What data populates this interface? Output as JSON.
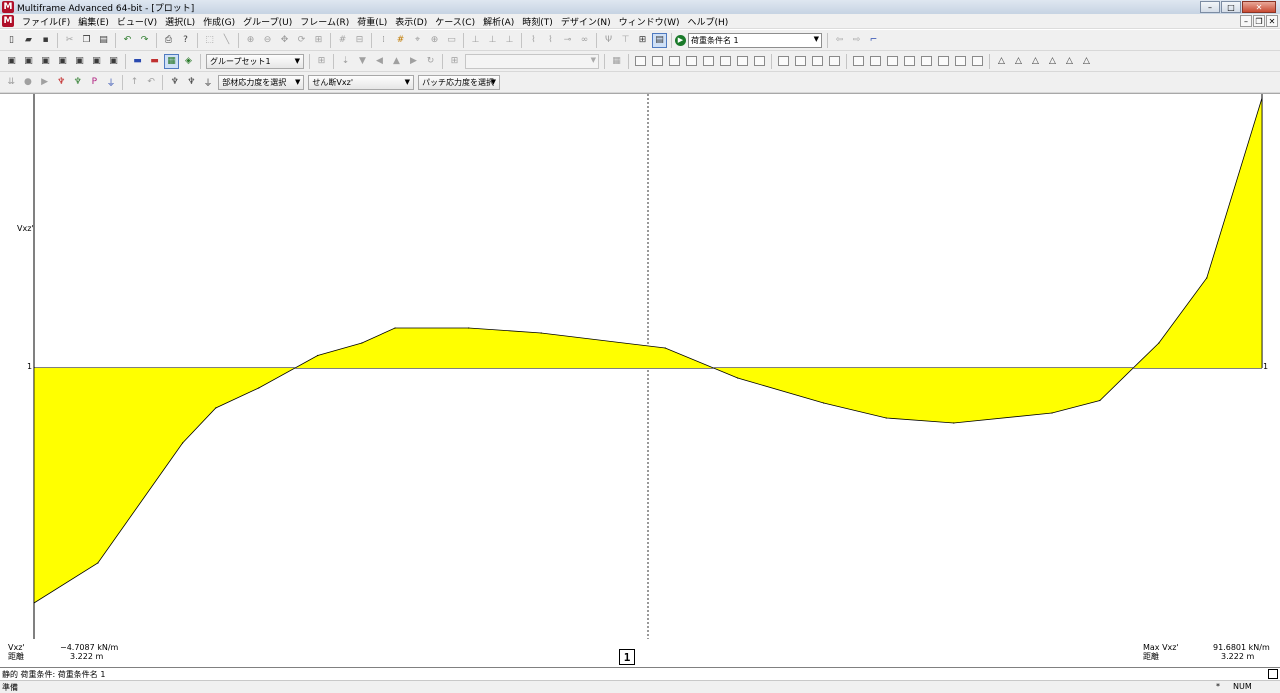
{
  "window": {
    "title": "Multiframe Advanced 64-bit - [プロット]",
    "logo": "M"
  },
  "menu": [
    "ファイル(F)",
    "編集(E)",
    "ビュー(V)",
    "選択(L)",
    "作成(G)",
    "グループ(U)",
    "フレーム(R)",
    "荷重(L)",
    "表示(D)",
    "ケース(C)",
    "解析(A)",
    "時刻(T)",
    "デザイン(N)",
    "ウィンドウ(W)",
    "ヘルプ(H)"
  ],
  "toolbar1": {
    "load_case_combo": "荷重条件名 1"
  },
  "toolbar2": {
    "group_set_combo": "グループセット1",
    "empty_combo": ""
  },
  "toolbar3": {
    "member_stress_combo": "部材応力度を選択",
    "shear_combo": "せん断Vxz'",
    "patch_stress_combo": "パッチ応力度を選択"
  },
  "plot": {
    "y_axis_label": "Vxz'",
    "left_zero_label": "1",
    "right_zero_label": "1",
    "min_info": {
      "label": "Vxz'",
      "value": "−4.7087 kN/m",
      "dist_label": "距離",
      "dist_value": "3.222 m"
    },
    "max_info": {
      "label": "Max Vxz'",
      "value": "91.6801 kN/m",
      "dist_label": "距離",
      "dist_value": "3.222 m"
    },
    "center_marker": "1",
    "colors": {
      "fill": "#ffff00",
      "line": "#000000"
    }
  },
  "chart_data": {
    "type": "area",
    "x": [
      0,
      0.052,
      0.121,
      0.148,
      0.183,
      0.231,
      0.267,
      0.294,
      0.354,
      0.413,
      0.514,
      0.573,
      0.643,
      0.694,
      0.749,
      0.829,
      0.868,
      0.916,
      0.955,
      1
    ],
    "y": [
      -0.47,
      -0.39,
      -0.15,
      -0.08,
      -0.04,
      0.025,
      0.05,
      0.08,
      0.08,
      0.07,
      0.04,
      -0.02,
      -0.07,
      -0.1,
      -0.11,
      -0.09,
      -0.065,
      0.05,
      0.18,
      0.54
    ]
  },
  "status": {
    "line": "静的 荷重条件: 荷重条件名 1",
    "ready": "準備",
    "star": "*",
    "num": "NUM"
  }
}
